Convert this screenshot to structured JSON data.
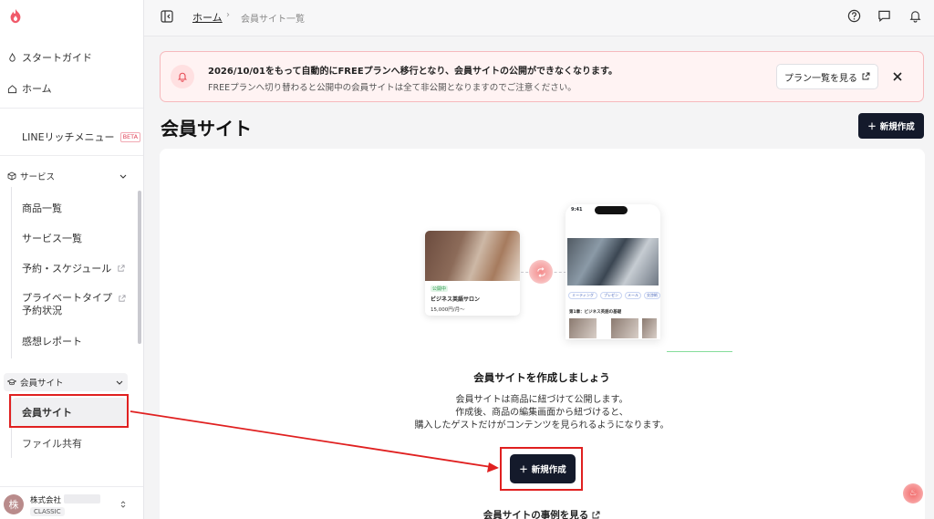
{
  "sidebar": {
    "start_guide": "スタートガイド",
    "home": "ホーム",
    "line_rich_menu": "LINEリッチメニュー",
    "beta": "BETA",
    "services_header": "サービス",
    "service_items": [
      "商品一覧",
      "サービス一覧",
      "予約・スケジュール",
      "プライベートタイプ\n予約状況",
      "感想レポート"
    ],
    "member_header": "会員サイト",
    "member_items": [
      "会員サイト",
      "ファイル共有"
    ],
    "company_name": "株式会社",
    "avatar_char": "株",
    "plan": "CLASSIC"
  },
  "topbar": {
    "breadcrumb_home": "ホーム",
    "breadcrumb_sep": "›",
    "breadcrumb_current": "会員サイト一覧"
  },
  "alert": {
    "title": "2026/10/01をもって自動的にFREEプランへ移行となり、会員サイトの公開ができなくなります。",
    "subtitle": "FREEプランへ切り替わると公開中の会員サイトは全て非公開となりますのでご注意ください。",
    "plans_button": "プラン一覧を見る"
  },
  "page": {
    "title": "会員サイト",
    "new_button": "新規作成"
  },
  "illustration": {
    "badge": "公開中",
    "card_title": "ビジネス英語サロン",
    "card_price": "15,000円/月〜",
    "phone_time": "9:41",
    "chips": [
      "ミーティング",
      "プレゼン",
      "メール",
      "交渉術"
    ],
    "section": "第1章：ビジネス英語の基礎"
  },
  "empty": {
    "title": "会員サイトを作成しましょう",
    "lines": [
      "会員サイトは商品に紐づけて公開します。",
      "作成後、商品の編集画面から紐づけると、",
      "購入したゲストだけがコンテンツを見られるようになります。"
    ],
    "new_button": "新規作成",
    "examples_link": "会員サイトの事例を見る"
  },
  "colors": {
    "primary_button": "#141a2b",
    "alert_bg": "#fff3f3",
    "alert_border": "#f6b9bd",
    "annotation_red": "#e02020"
  }
}
